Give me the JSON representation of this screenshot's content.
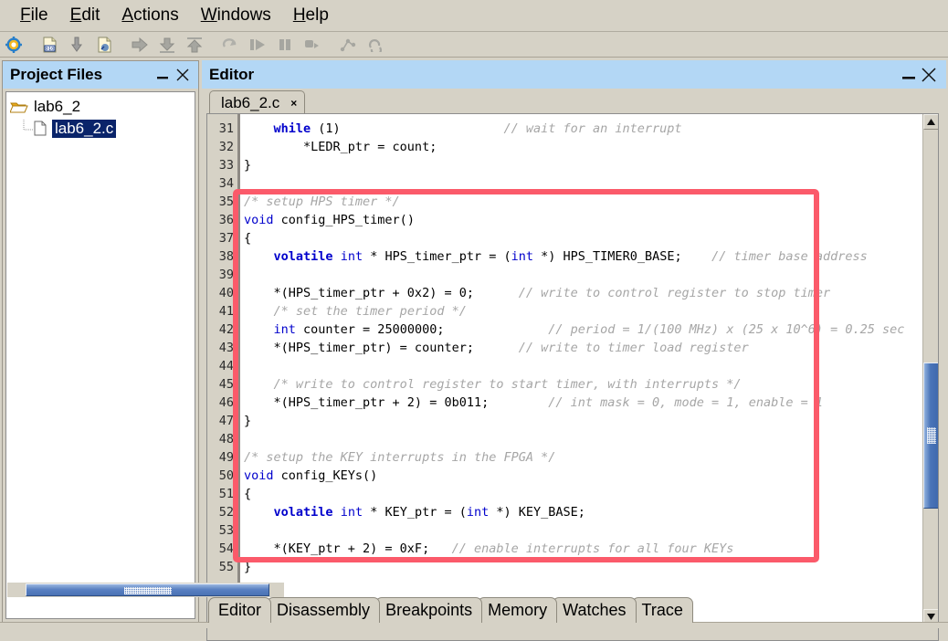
{
  "menubar": {
    "items": [
      {
        "label": "File",
        "mnemonic": "F"
      },
      {
        "label": "Edit",
        "mnemonic": "E"
      },
      {
        "label": "Actions",
        "mnemonic": "A"
      },
      {
        "label": "Windows",
        "mnemonic": "W"
      },
      {
        "label": "Help",
        "mnemonic": "H"
      }
    ]
  },
  "toolbar": {
    "buttons": [
      {
        "name": "settings-gear-icon",
        "enabled": true
      },
      {
        "name": "compile-icon",
        "enabled": true
      },
      {
        "name": "download-icon",
        "enabled": true
      },
      {
        "name": "load-file-icon",
        "enabled": true
      },
      {
        "name": "continue-icon",
        "enabled": false
      },
      {
        "name": "step-into-icon",
        "enabled": false
      },
      {
        "name": "step-out-icon",
        "enabled": false
      },
      {
        "name": "restart-icon",
        "enabled": false
      },
      {
        "name": "run-icon",
        "enabled": false
      },
      {
        "name": "pause-icon",
        "enabled": false
      },
      {
        "name": "step-over-icon",
        "enabled": false
      },
      {
        "name": "branch-icon",
        "enabled": false
      },
      {
        "name": "refresh-icon",
        "enabled": false
      }
    ]
  },
  "project_files": {
    "title": "Project Files",
    "minimize_label": "—",
    "close_label": "✕",
    "tree": {
      "root": {
        "label": "lab6_2",
        "icon": "folder-open-icon"
      },
      "child": {
        "label": "lab6_2.c",
        "icon": "file-icon",
        "selected": true
      }
    }
  },
  "editor": {
    "title": "Editor",
    "minimize_label": "—",
    "close_label": "✕",
    "file_tab": {
      "label": "lab6_2.c",
      "close_label": "×"
    },
    "code_lines": [
      {
        "num": "31",
        "html": "    <span class='kwb'>while</span> (1)                      <span class='cm'>// wait for an interrupt</span>"
      },
      {
        "num": "32",
        "html": "        *LEDR_ptr = count;"
      },
      {
        "num": "33",
        "html": "}"
      },
      {
        "num": "34",
        "html": ""
      },
      {
        "num": "35",
        "html": "<span class='cm'>/* setup HPS timer */</span>"
      },
      {
        "num": "36",
        "html": "<span class='kw'>void</span> config_HPS_timer()"
      },
      {
        "num": "37",
        "html": "{"
      },
      {
        "num": "38",
        "html": "    <span class='kwb'>volatile</span> <span class='kw'>int</span> * HPS_timer_ptr = (<span class='kw'>int</span> *) HPS_TIMER0_BASE;    <span class='cm'>// timer base address</span>"
      },
      {
        "num": "39",
        "html": ""
      },
      {
        "num": "40",
        "html": "    *(HPS_timer_ptr + 0x2) = 0;      <span class='cm'>// write to control register to stop timer</span>"
      },
      {
        "num": "41",
        "html": "    <span class='cm'>/* set the timer period */</span>"
      },
      {
        "num": "42",
        "html": "    <span class='kw'>int</span> counter = 25000000;              <span class='cm'>// period = 1/(100 MHz) x (25 x 10^6) = 0.25 sec</span>"
      },
      {
        "num": "43",
        "html": "    *(HPS_timer_ptr) = counter;      <span class='cm'>// write to timer load register</span>"
      },
      {
        "num": "44",
        "html": ""
      },
      {
        "num": "45",
        "html": "    <span class='cm'>/* write to control register to start timer, with interrupts */</span>"
      },
      {
        "num": "46",
        "html": "    *(HPS_timer_ptr + 2) = 0b011;        <span class='cm'>// int mask = 0, mode = 1, enable = 1</span>"
      },
      {
        "num": "47",
        "html": "}"
      },
      {
        "num": "48",
        "html": ""
      },
      {
        "num": "49",
        "html": "<span class='cm'>/* setup the KEY interrupts in the FPGA */</span>"
      },
      {
        "num": "50",
        "html": "<span class='kw'>void</span> config_KEYs()"
      },
      {
        "num": "51",
        "html": "{"
      },
      {
        "num": "52",
        "html": "    <span class='kwb'>volatile</span> <span class='kw'>int</span> * KEY_ptr = (<span class='kw'>int</span> *) KEY_BASE;"
      },
      {
        "num": "53",
        "html": ""
      },
      {
        "num": "54",
        "html": "    *(KEY_ptr + 2) = 0xF;   <span class='cm'>// enable interrupts for all four KEYs</span>"
      },
      {
        "num": "55",
        "html": "}"
      }
    ],
    "code_plain": [
      "    while (1)                      // wait for an interrupt",
      "        *LEDR_ptr = count;",
      "}",
      "",
      "/* setup HPS timer */",
      "void config_HPS_timer()",
      "{",
      "    volatile int * HPS_timer_ptr = (int *) HPS_TIMER0_BASE;    // timer base address",
      "",
      "    *(HPS_timer_ptr + 0x2) = 0;      // write to control register to stop timer",
      "    /* set the timer period */",
      "    int counter = 25000000;              // period = 1/(100 MHz) x (25 x 10^6) = 0.25 sec",
      "    *(HPS_timer_ptr) = counter;      // write to timer load register",
      "",
      "    /* write to control register to start timer, with interrupts */",
      "    *(HPS_timer_ptr + 2) = 0b011;        // int mask = 0, mode = 1, enable = 1",
      "}",
      "",
      "/* setup the KEY interrupts in the FPGA */",
      "void config_KEYs()",
      "{",
      "    volatile int * KEY_ptr = (int *) KEY_BASE;",
      "",
      "    *(KEY_ptr + 2) = 0xF;   // enable interrupts for all four KEYs",
      "}"
    ],
    "vscroll": {
      "up_arrow": "▲",
      "down_arrow": "▼"
    },
    "hscroll": {
      "left_arrow": "◀",
      "right_arrow": "▶"
    }
  },
  "bottom_tabs": {
    "items": [
      {
        "label": "Editor",
        "active": true
      },
      {
        "label": "Disassembly",
        "active": false
      },
      {
        "label": "Breakpoints",
        "active": false
      },
      {
        "label": "Memory",
        "active": false
      },
      {
        "label": "Watches",
        "active": false
      },
      {
        "label": "Trace",
        "active": false
      }
    ]
  },
  "annotation": {
    "highlight_color": "#fb5a6a",
    "name": "red-highlight-rectangle"
  },
  "colors": {
    "window_chrome": "#d6d2c6",
    "title_active": "#b3d7f5",
    "keyword_blue": "#0000cc",
    "comment_gray": "#a6a6a6",
    "selection_blue": "#0a246a",
    "scrollbar_thumb": "#4a74b8"
  }
}
